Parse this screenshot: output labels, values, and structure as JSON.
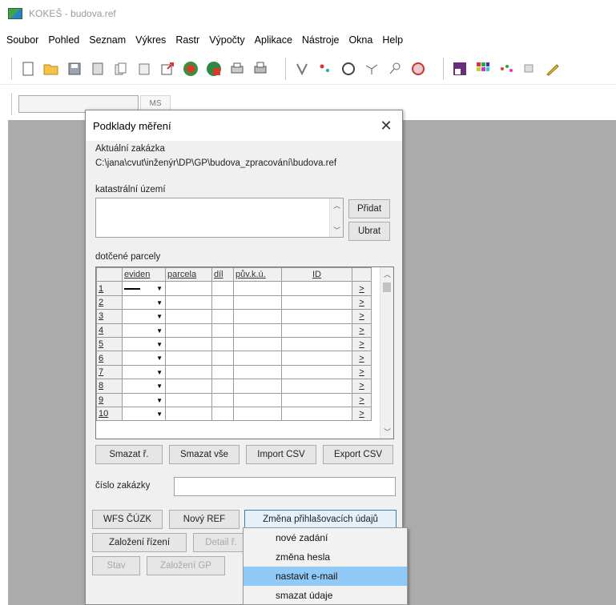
{
  "window": {
    "title": "KOKEŠ - budova.ref"
  },
  "menu": [
    "Soubor",
    "Pohled",
    "Seznam",
    "Výkres",
    "Rastr",
    "Výpočty",
    "Aplikace",
    "Nástroje",
    "Okna",
    "Help"
  ],
  "toolbar2": {
    "small_button": "MS"
  },
  "dialog": {
    "title": "Podklady měření",
    "close_symbol": "✕",
    "order_label": "Aktuální zakázka",
    "order_path": "C:\\jana\\cvut\\inženýr\\DP\\GP\\budova_zpracování\\budova.ref",
    "cadastral_label": "katastrální území",
    "add_label": "Přidat",
    "remove_label": "Ubrat",
    "parcels_label": "dotčené parcely",
    "grid": {
      "columns": [
        "",
        "eviden",
        "parcela",
        "díl",
        "pův.k.ú.",
        "ID",
        ""
      ],
      "rows": [
        "1",
        "2",
        "3",
        "4",
        "5",
        "6",
        "7",
        "8",
        "9",
        "10"
      ],
      "go_symbol": ">"
    },
    "buttons": {
      "delete_row": "Smazat ř.",
      "delete_all": "Smazat vše",
      "import_csv": "Import CSV",
      "export_csv": "Export CSV",
      "wfs": "WFS ČÚZK",
      "new_ref": "Nový REF",
      "change_login": "Změna přihlašovacích údajů",
      "create_proc": "Založení řízení",
      "details": "Detail ř.",
      "state": "Stav",
      "create_gp": "Založení GP"
    },
    "order_number_label": "číslo zakázky",
    "order_number_value": ""
  },
  "popup_menu": {
    "items": [
      "nové zadání",
      "změna hesla",
      "nastavit e-mail",
      "smazat údaje"
    ],
    "selected": "nastavit e-mail"
  }
}
